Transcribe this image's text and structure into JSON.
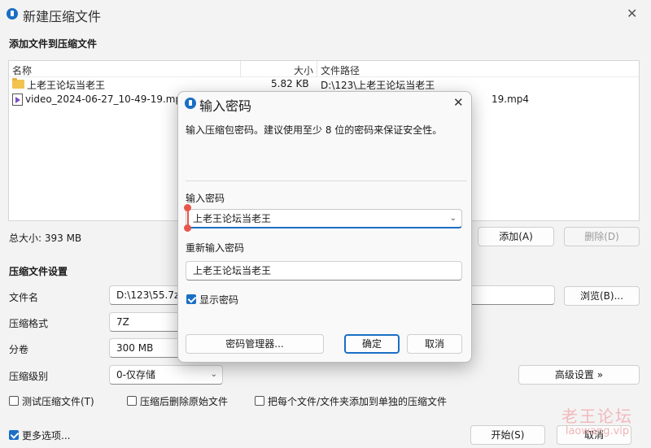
{
  "window": {
    "title": "新建压缩文件",
    "close": "✕"
  },
  "files_section": {
    "title": "添加文件到压缩文件",
    "columns": {
      "name": "名称",
      "size": "大小",
      "path": "文件路径"
    },
    "rows": [
      {
        "icon": "folder-icon",
        "name": "上老王论坛当老王",
        "size": "5.82 KB",
        "path": "D:\\123\\上老王论坛当老王"
      },
      {
        "icon": "video-file-icon",
        "name": "video_2024-06-27_10-49-19.mp4",
        "size": "",
        "path": "19.mp4"
      }
    ],
    "total_size": "总大小: 393 MB",
    "add_label": "添加(A)",
    "delete_label": "删除(D)"
  },
  "settings": {
    "title": "压缩文件设置",
    "filename_label": "文件名",
    "filename_value": "D:\\123\\55.7z",
    "browse_label": "浏览(B)...",
    "format_label": "压缩格式",
    "format_value": "7Z",
    "volume_label": "分卷",
    "volume_value": "300 MB",
    "level_label": "压缩级别",
    "level_value": "0-仅存储",
    "advanced_label": "高级设置 »",
    "test_label": "测试压缩文件(T)",
    "delete_after_label": "压缩后删除原始文件",
    "separate_label": "把每个文件/文件夹添加到单独的压缩文件"
  },
  "footer": {
    "more_options_label": "更多选项...",
    "start_label": "开始(S)",
    "cancel_label": "取消"
  },
  "dialog": {
    "title": "输入密码",
    "close": "✕",
    "description": "输入压缩包密码。建议使用至少 8 位的密码来保证安全性。",
    "password_label": "输入密码",
    "password_value": "上老王论坛当老王",
    "reenter_label": "重新输入密码",
    "reenter_value": "上老王论坛当老王",
    "show_password_label": "显示密码",
    "show_password_checked": true,
    "manager_label": "密码管理器...",
    "ok_label": "确定",
    "cancel_label": "取消"
  },
  "watermark": {
    "logo": "老王论坛",
    "url": "laowang.vip"
  },
  "colors": {
    "accent": "#1a6fc4",
    "marker": "#e8554a",
    "watermark": "#f2b8bb"
  }
}
